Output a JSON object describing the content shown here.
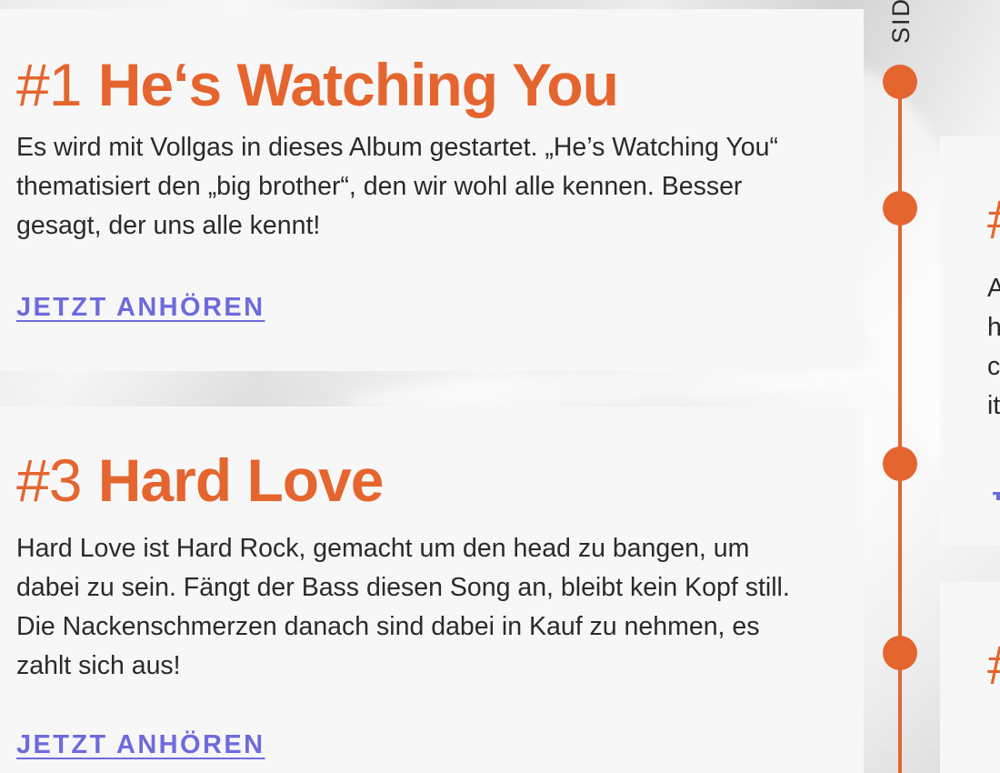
{
  "side_label": "SIDE",
  "songs_left": [
    {
      "number": "#1",
      "title": "He‘s Watching You",
      "description": "Es wird mit Vollgas in dieses Album gestartet. „He’s Watching You“ thematisiert den „big brother“, den wir wohl alle kennen. Besser gesagt, der uns alle kennt!",
      "link": "JETZT ANHÖREN"
    },
    {
      "number": "#3",
      "title": "Hard Love",
      "description": "Hard Love ist Hard Rock, gemacht um den head zu bangen, um dabei zu sein. Fängt der Bass diesen Song an, bleibt kein Kopf still. Die Nackenschmerzen danach sind dabei in Kauf zu nehmen, es zahlt sich aus!",
      "link": "JETZT ANHÖREN"
    }
  ],
  "right_fragments": {
    "hash_1": "#",
    "lines": [
      "A",
      "h",
      "c",
      "it"
    ],
    "link_frag": "J",
    "hash_2": "#"
  },
  "colors": {
    "accent": "#e5652f",
    "link": "#6d6bdc",
    "text": "#2a2a2a",
    "card": "#f7f7f7"
  }
}
